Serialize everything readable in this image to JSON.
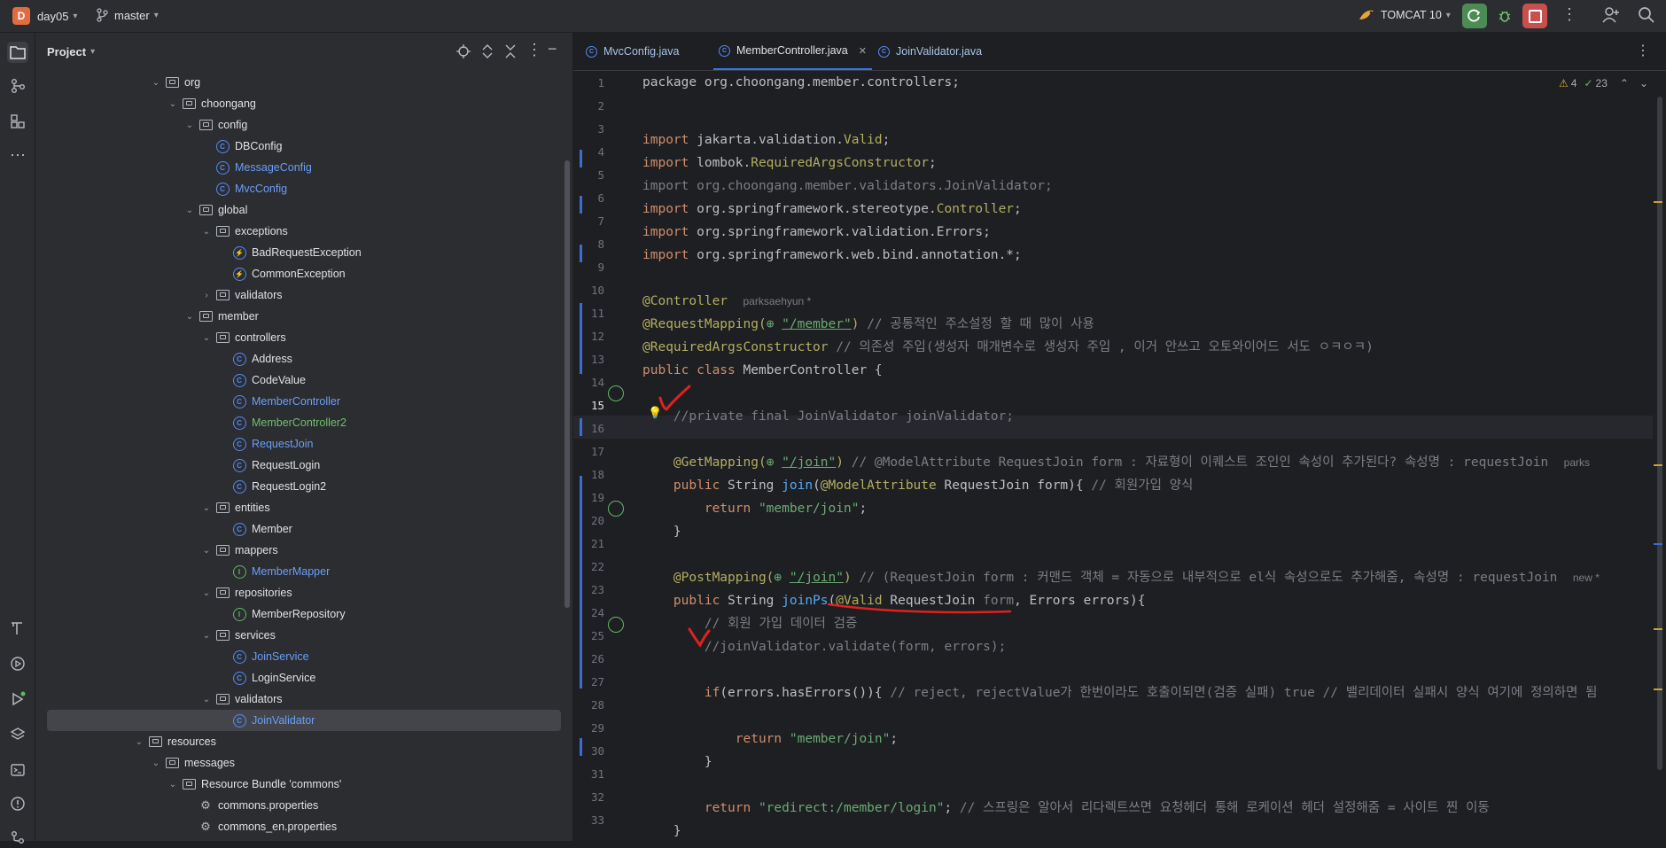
{
  "topbar": {
    "project_badge": "D",
    "project_name": "day05",
    "branch": "master",
    "run_config": "TOMCAT 10"
  },
  "project_panel": {
    "title": "Project",
    "tree": [
      {
        "label": "org",
        "kind": "folder",
        "depth": 0,
        "expanded": true
      },
      {
        "label": "choongang",
        "kind": "folder",
        "depth": 1,
        "expanded": true
      },
      {
        "label": "config",
        "kind": "folder",
        "depth": 2,
        "expanded": true
      },
      {
        "label": "DBConfig",
        "kind": "class",
        "depth": 3
      },
      {
        "label": "MessageConfig",
        "kind": "class",
        "depth": 3,
        "color": "blue"
      },
      {
        "label": "MvcConfig",
        "kind": "class",
        "depth": 3,
        "color": "blue"
      },
      {
        "label": "global",
        "kind": "folder",
        "depth": 2,
        "expanded": true
      },
      {
        "label": "exceptions",
        "kind": "folder",
        "depth": 3,
        "expanded": true
      },
      {
        "label": "BadRequestException",
        "kind": "exception",
        "depth": 4
      },
      {
        "label": "CommonException",
        "kind": "exception",
        "depth": 4
      },
      {
        "label": "validators",
        "kind": "folder",
        "depth": 3,
        "expanded": false
      },
      {
        "label": "member",
        "kind": "folder",
        "depth": 2,
        "expanded": true
      },
      {
        "label": "controllers",
        "kind": "folder",
        "depth": 3,
        "expanded": true
      },
      {
        "label": "Address",
        "kind": "class",
        "depth": 4
      },
      {
        "label": "CodeValue",
        "kind": "class",
        "depth": 4
      },
      {
        "label": "MemberController",
        "kind": "class",
        "depth": 4,
        "color": "blue"
      },
      {
        "label": "MemberController2",
        "kind": "class",
        "depth": 4,
        "color": "green"
      },
      {
        "label": "RequestJoin",
        "kind": "class",
        "depth": 4,
        "color": "blue"
      },
      {
        "label": "RequestLogin",
        "kind": "class",
        "depth": 4
      },
      {
        "label": "RequestLogin2",
        "kind": "class",
        "depth": 4
      },
      {
        "label": "entities",
        "kind": "folder",
        "depth": 3,
        "expanded": true
      },
      {
        "label": "Member",
        "kind": "class",
        "depth": 4
      },
      {
        "label": "mappers",
        "kind": "folder",
        "depth": 3,
        "expanded": true
      },
      {
        "label": "MemberMapper",
        "kind": "interface",
        "depth": 4,
        "color": "blue"
      },
      {
        "label": "repositories",
        "kind": "folder",
        "depth": 3,
        "expanded": true
      },
      {
        "label": "MemberRepository",
        "kind": "interface",
        "depth": 4
      },
      {
        "label": "services",
        "kind": "folder",
        "depth": 3,
        "expanded": true
      },
      {
        "label": "JoinService",
        "kind": "class",
        "depth": 4,
        "color": "blue"
      },
      {
        "label": "LoginService",
        "kind": "class",
        "depth": 4
      },
      {
        "label": "validators",
        "kind": "folder",
        "depth": 3,
        "expanded": true
      },
      {
        "label": "JoinValidator",
        "kind": "class",
        "depth": 4,
        "color": "blue",
        "selected": true
      },
      {
        "label": "resources",
        "kind": "folder",
        "depth": -1,
        "expanded": true
      },
      {
        "label": "messages",
        "kind": "folder",
        "depth": 0,
        "expanded": true
      },
      {
        "label": "Resource Bundle 'commons'",
        "kind": "folder",
        "depth": 1,
        "expanded": true
      },
      {
        "label": "commons.properties",
        "kind": "props",
        "depth": 2
      },
      {
        "label": "commons_en.properties",
        "kind": "props",
        "depth": 2
      }
    ]
  },
  "editor": {
    "tabs": [
      {
        "label": "MvcConfig.java",
        "active": false
      },
      {
        "label": "MemberController.java",
        "active": true
      },
      {
        "label": "JoinValidator.java",
        "active": false
      }
    ],
    "close_glyph": "✕",
    "inspections": {
      "warnings": "4",
      "ok": "23"
    },
    "line_numbers": [
      "1",
      "2",
      "3",
      "4",
      "5",
      "6",
      "7",
      "8",
      "9",
      "10",
      "11",
      "12",
      "13",
      "14",
      "15",
      "16",
      "17",
      "18",
      "19",
      "20",
      "21",
      "22",
      "23",
      "24",
      "25",
      "26",
      "27",
      "28",
      "29",
      "30",
      "31",
      "32",
      "33"
    ],
    "code": {
      "l1": "package org.choongang.member.controllers;",
      "l3_kw": "import ",
      "l3_a": "jakarta.validation.",
      "l3_b": "Valid",
      "l3_c": ";",
      "l4_kw": "import ",
      "l4_a": "lombok.",
      "l4_b": "RequiredArgsConstructor",
      "l4_c": ";",
      "l5": "import org.choongang.member.validators.JoinValidator;",
      "l6_kw": "import ",
      "l6_a": "org.springframework.stereotype.",
      "l6_b": "Controller",
      "l6_c": ";",
      "l7_kw": "import ",
      "l7_a": "org.springframework.validation.Errors;",
      "l8_kw": "import ",
      "l8_a": "org.springframework.web.bind.annotation.*;",
      "l10_an": "@Controller",
      "l10_author": "parksaehyun *",
      "l11_an": "@RequestMapping(",
      "l11_str": "\"/member\"",
      "l11_b": ")",
      "l11_cm": " // 공통적인 주소설정 할 때 많이 사용",
      "l12_an": "@RequiredArgsConstructor",
      "l12_cm": " // 의존성 주입(생성자 매개변수로 생성자 주입 , 이거 안쓰고 오토와이어드 서도 ㅇㅋㅇㅋ)",
      "l13_kw": "public class ",
      "l13_a": "MemberController {",
      "l15": "//private final JoinValidator joinValidator;",
      "l17_an": "@GetMapping(",
      "l17_str": "\"/join\"",
      "l17_b": ")",
      "l17_cm": " // @ModelAttribute RequestJoin form : 자료형이 이퀘스트 조인인 속성이 추가된다? 속성명 : requestJoin",
      "l17_author": "parks",
      "l18_kw": "public ",
      "l18_a": "String ",
      "l18_fn": "join",
      "l18_b": "(",
      "l18_an": "@ModelAttribute",
      "l18_c": " RequestJoin form){",
      "l18_cm": " // 회원가입 양식",
      "l19_kw": "return ",
      "l19_str": "\"member/join\"",
      "l19_c": ";",
      "l20": "}",
      "l22_an": "@PostMapping(",
      "l22_str": "\"/join\"",
      "l22_b": ")",
      "l22_cm": " // (RequestJoin form : 커맨드 객체 = 자동으로 내부적으로 el식 속성으로도 추가해줌, 속성명 : requestJoin",
      "l22_author": "new *",
      "l23_kw": "public ",
      "l23_a": "String ",
      "l23_fn": "joinPs",
      "l23_b": "(",
      "l23_an": "@Valid",
      "l23_c": " RequestJoin ",
      "l23_d": "form",
      "l23_e": ", Errors errors){",
      "l24_cm": "// 회원 가입 데이터 검증",
      "l25": "//joinValidator.validate(form, errors);",
      "l27_kw": "if",
      "l27_a": "(errors.hasErrors()){",
      "l27_cm": " // reject, rejectValue가 한번이라도 호출이되면(검증 실패) true // 밸리데이터 실패시 양식 여기에 정의하면 됨",
      "l29_kw": "return ",
      "l29_str": "\"member/join\"",
      "l29_c": ";",
      "l30": "}",
      "l32_kw": "return ",
      "l32_str": "\"redirect:/member/login\"",
      "l32_c": ";",
      "l32_cm": " // 스프링은 알아서 리다렉트쓰면 요청헤더 통해 로케이션 헤더 설정해줌 = 사이트 찐 이동",
      "l33": "}"
    }
  },
  "colors": {
    "accent": "#3574f0",
    "keyword": "#cf8e6d",
    "annotation": "#b3ae60",
    "string": "#6aab73",
    "comment": "#7a7e85",
    "pen": "#e0211f"
  }
}
